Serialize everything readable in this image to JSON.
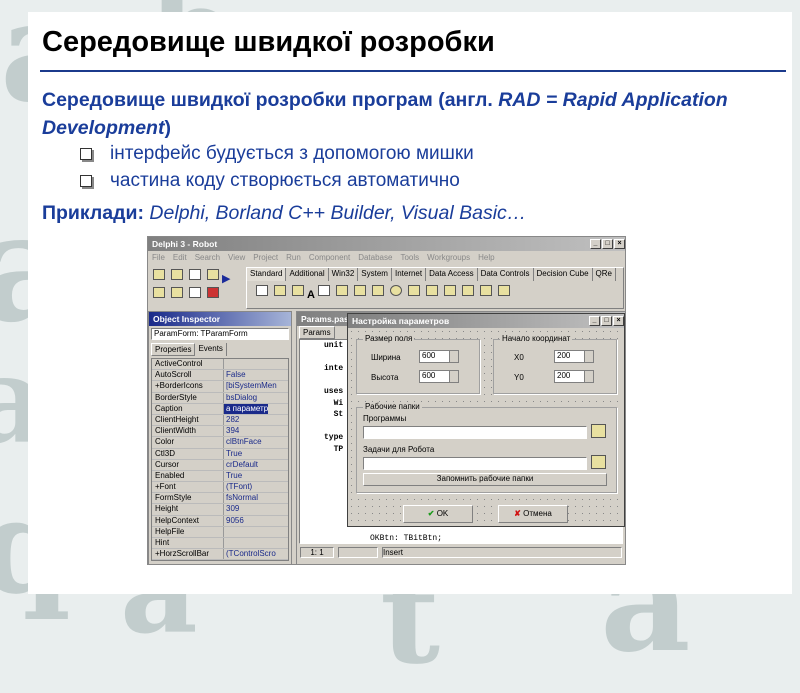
{
  "background_letters": [
    "a",
    "b",
    "y",
    "a",
    "z",
    "a",
    "b",
    "f",
    "a",
    "a",
    "q",
    "a",
    "t",
    "a"
  ],
  "slide": {
    "title": "Середовище швидкої розробки",
    "subtitle_a": "Середовище швидкої розробки програм (англ. ",
    "subtitle_b": "RAD = Rapid Application Development",
    "subtitle_c": ")",
    "bullets": [
      "інтерфейс будується з допомогою мишки",
      "частина коду створюється автоматично"
    ],
    "examples_label": "Приклади:",
    "examples": " Delphi, Borland C++ Builder, Visual Basic…"
  },
  "ide": {
    "title": "Delphi 3 - Robot",
    "menu": [
      "File",
      "Edit",
      "Search",
      "View",
      "Project",
      "Run",
      "Component",
      "Database",
      "Tools",
      "Workgroups",
      "Help"
    ],
    "palette_tabs": [
      "Standard",
      "Additional",
      "Win32",
      "System",
      "Internet",
      "Data Access",
      "Data Controls",
      "Decision Cube",
      "QRe"
    ],
    "inspector": {
      "title": "Object Inspector",
      "object": "ParamForm: TParamForm",
      "tabs": [
        "Properties",
        "Events"
      ],
      "rows": [
        [
          "ActiveControl",
          ""
        ],
        [
          "AutoScroll",
          "False"
        ],
        [
          "+BorderIcons",
          "[biSystemMen"
        ],
        [
          "BorderStyle",
          "bsDialog"
        ],
        [
          "Caption",
          "а параметр"
        ],
        [
          "ClientHeight",
          "282"
        ],
        [
          "ClientWidth",
          "394"
        ],
        [
          "Color",
          "clBtnFace"
        ],
        [
          "Ctl3D",
          "True"
        ],
        [
          "Cursor",
          "crDefault"
        ],
        [
          "Enabled",
          "True"
        ],
        [
          "+Font",
          "(TFont)"
        ],
        [
          "FormStyle",
          "fsNormal"
        ],
        [
          "Height",
          "309"
        ],
        [
          "HelpContext",
          "9056"
        ],
        [
          "HelpFile",
          ""
        ],
        [
          "Hint",
          ""
        ],
        [
          "+HorzScrollBar",
          "(TControlScro"
        ]
      ]
    },
    "editor": {
      "title": "Params.pas",
      "tab": "Params",
      "code": [
        "unit",
        "",
        "inte",
        "",
        "uses",
        "  Wi",
        "  St",
        "",
        "type",
        "  TP"
      ],
      "tail": "OKBtn: TBitBtn;",
      "status": [
        "1: 1",
        "",
        "Insert"
      ]
    },
    "dialog": {
      "title": "Настройка параметров",
      "field_group": "Размер поля",
      "width_label": "Ширина",
      "width": "600",
      "height_label": "Высота",
      "height": "600",
      "origin_group": "Начало координат",
      "x0_label": "X0",
      "x0": "200",
      "y0_label": "Y0",
      "y0": "200",
      "folders_group": "Рабочие папки",
      "programs_label": "Программы",
      "tasks_label": "Задачи для Робота",
      "save_button": "Запомнить рабочие папки",
      "ok": "OK",
      "cancel": "Отмена"
    }
  }
}
